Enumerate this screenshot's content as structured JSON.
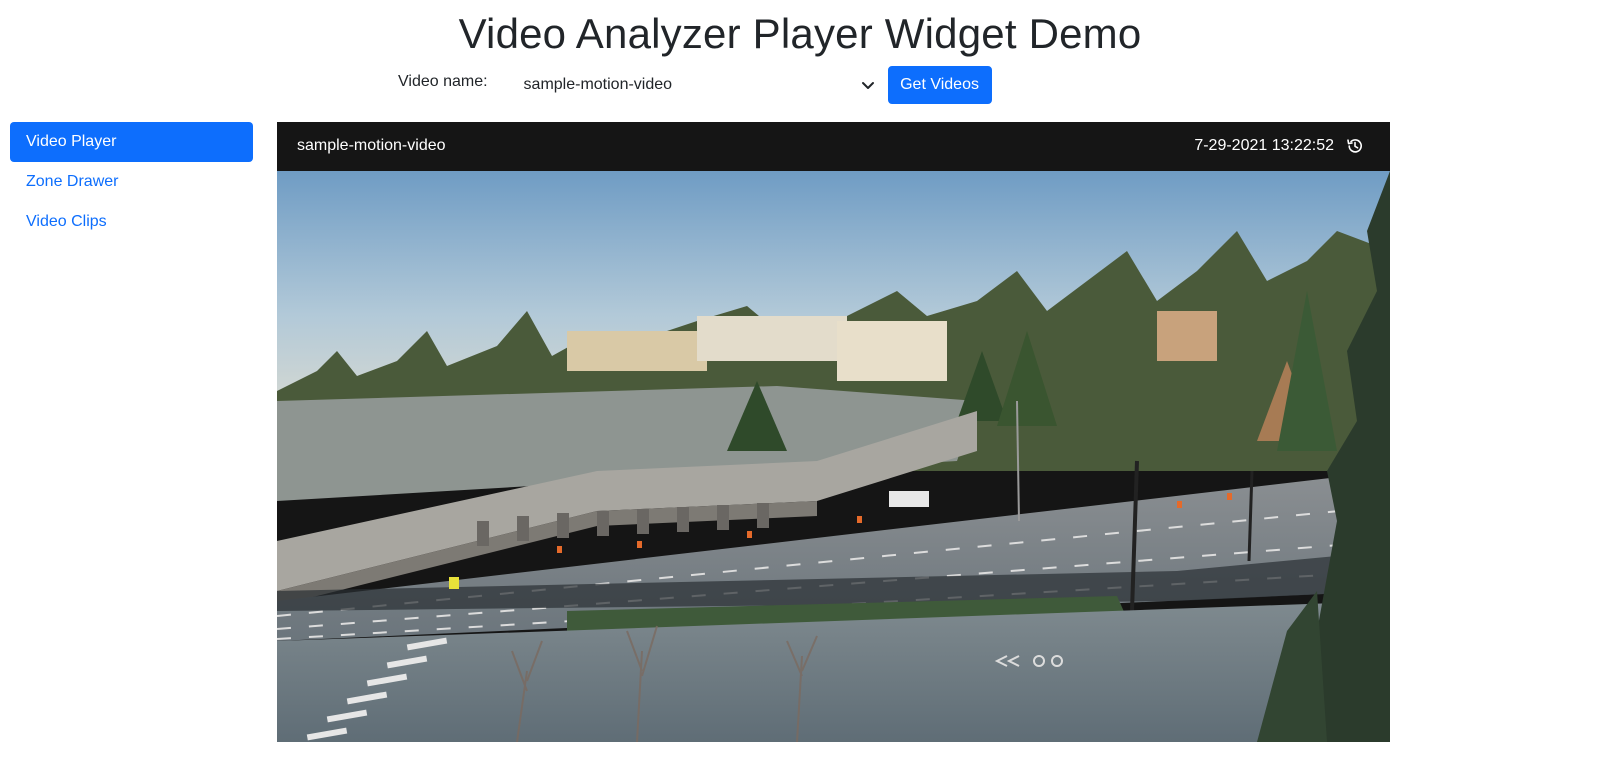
{
  "page": {
    "title": "Video Analyzer Player Widget Demo"
  },
  "controls": {
    "video_label": "Video name:",
    "selected_video": "sample-motion-video",
    "get_videos_label": "Get Videos"
  },
  "sidebar": {
    "items": [
      {
        "label": "Video Player",
        "active": true
      },
      {
        "label": "Zone Drawer",
        "active": false
      },
      {
        "label": "Video Clips",
        "active": false
      }
    ]
  },
  "player": {
    "title": "sample-motion-video",
    "timestamp": "7-29-2021 13:22:52",
    "history_icon": "history-icon",
    "scene_description_icon": "video-frame"
  },
  "colors": {
    "accent": "#0d6efd",
    "player_header_bg": "#151515"
  }
}
